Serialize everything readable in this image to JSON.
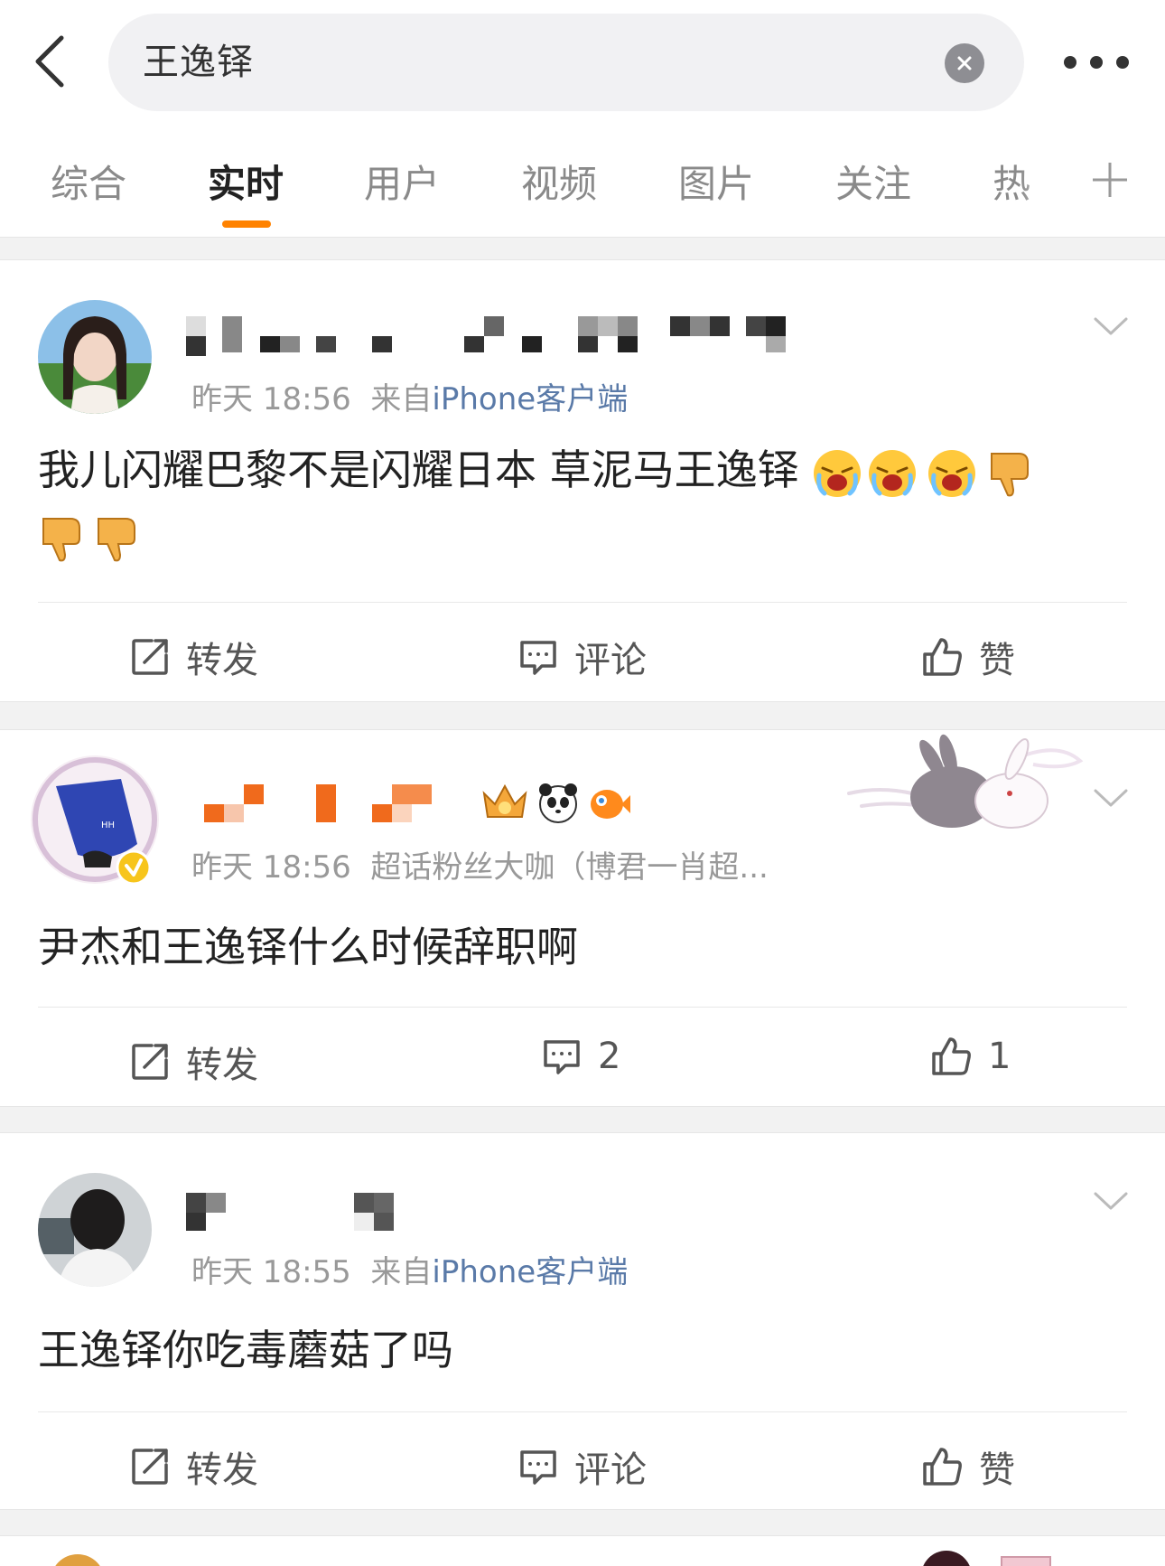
{
  "search": {
    "query": "王逸铎"
  },
  "tabs": [
    {
      "label": "综合"
    },
    {
      "label": "实时"
    },
    {
      "label": "用户"
    },
    {
      "label": "视频"
    },
    {
      "label": "图片"
    },
    {
      "label": "关注"
    },
    {
      "label": "热"
    }
  ],
  "active_tab": "实时",
  "posts": [
    {
      "time": "昨天 18:56",
      "source_prefix": "来自",
      "source": "iPhone客户端",
      "text_line1": "我儿闪耀巴黎不是闪耀日本 草泥马王逸铎",
      "repost_label": "转发",
      "comment_label": "评论",
      "like_label": "赞"
    },
    {
      "time": "昨天 18:56",
      "badge": "超话粉丝大咖（博君一肖超...",
      "text_line1": "尹杰和王逸铎什么时候辞职啊",
      "repost_label": "转发",
      "comment_label": "2",
      "like_label": "1"
    },
    {
      "time": "昨天 18:55",
      "source_prefix": "来自",
      "source": "iPhone客户端",
      "text_line1": "王逸铎你吃毒蘑菇了吗",
      "repost_label": "转发",
      "comment_label": "评论",
      "like_label": "赞"
    }
  ],
  "colors": {
    "accent": "#ff8200",
    "source_link": "#5a7aa8",
    "verified": "#f7c51c"
  },
  "icons": [
    "back-arrow-icon",
    "clear-icon",
    "more-icon",
    "plus-icon",
    "chevron-down-icon",
    "repost-icon",
    "comment-icon",
    "like-icon",
    "crying-emoji-icon",
    "thumbs-down-emoji-icon"
  ]
}
